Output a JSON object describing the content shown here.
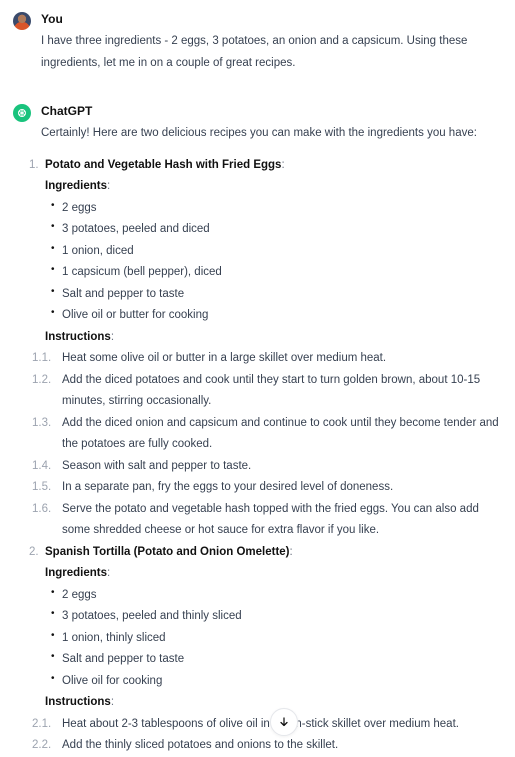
{
  "user": {
    "name": "You",
    "message": "I have three ingredients - 2 eggs, 3 potatoes, an onion and a capsicum. Using these ingredients, let me in on a couple of great recipes."
  },
  "assistant": {
    "name": "ChatGPT",
    "intro": "Certainly! Here are two delicious recipes you can make with the ingredients you have:",
    "recipes": [
      {
        "number": "1.",
        "title": "Potato and Vegetable Hash with Fried Eggs",
        "ingredients_label": "Ingredients",
        "ingredients": [
          "2 eggs",
          "3 potatoes, peeled and diced",
          "1 onion, diced",
          "1 capsicum (bell pepper), diced",
          "Salt and pepper to taste",
          "Olive oil or butter for cooking"
        ],
        "instructions_label": "Instructions",
        "steps": [
          {
            "num": "1.1.",
            "text": "Heat some olive oil or butter in a large skillet over medium heat."
          },
          {
            "num": "1.2.",
            "text": "Add the diced potatoes and cook until they start to turn golden brown, about 10-15 minutes, stirring occasionally."
          },
          {
            "num": "1.3.",
            "text": "Add the diced onion and capsicum and continue to cook until they become tender and the potatoes are fully cooked."
          },
          {
            "num": "1.4.",
            "text": "Season with salt and pepper to taste."
          },
          {
            "num": "1.5.",
            "text": "In a separate pan, fry the eggs to your desired level of doneness."
          },
          {
            "num": "1.6.",
            "text": "Serve the potato and vegetable hash topped with the fried eggs. You can also add some shredded cheese or hot sauce for extra flavor if you like."
          }
        ]
      },
      {
        "number": "2.",
        "title": "Spanish Tortilla (Potato and Onion Omelette)",
        "ingredients_label": "Ingredients",
        "ingredients": [
          "2 eggs",
          "3 potatoes, peeled and thinly sliced",
          "1 onion, thinly sliced",
          "Salt and pepper to taste",
          "Olive oil for cooking"
        ],
        "instructions_label": "Instructions",
        "steps": [
          {
            "num": "2.1.",
            "text": "Heat about 2-3 tablespoons of olive oil in a non-stick skillet over medium heat."
          },
          {
            "num": "2.2.",
            "text": "Add the thinly sliced potatoes and onions to the skillet."
          }
        ]
      }
    ]
  },
  "scroll_button": {
    "icon": "arrow-down-icon"
  },
  "colors": {
    "assistant_avatar": "#19c37d",
    "text": "#374151",
    "heading": "#111111",
    "muted": "#9ca3af"
  }
}
